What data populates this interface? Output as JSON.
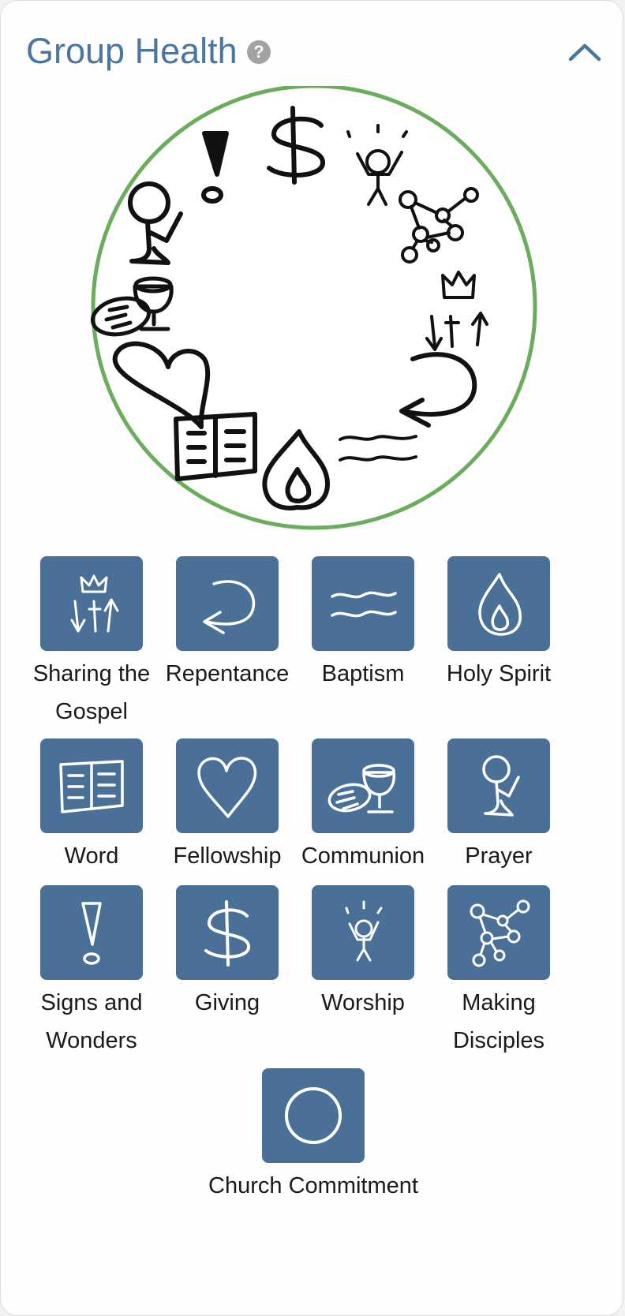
{
  "header": {
    "title": "Group Health",
    "help_glyph": "?",
    "help_icon": "question-circle-icon",
    "collapse_icon": "chevron-up-icon"
  },
  "colors": {
    "accent": "#4a76a0",
    "tile_background": "#4a7098",
    "circle_border": "#6aad5c",
    "help_icon": "#a2a2a2"
  },
  "practices": [
    {
      "label": "Sharing the Gospel",
      "icon": "crown-arrows-icon"
    },
    {
      "label": "Repentance",
      "icon": "u-turn-arrow-icon"
    },
    {
      "label": "Baptism",
      "icon": "water-waves-icon"
    },
    {
      "label": "Holy Spirit",
      "icon": "flame-icon"
    },
    {
      "label": "Word",
      "icon": "open-book-icon"
    },
    {
      "label": "Fellowship",
      "icon": "heart-icon"
    },
    {
      "label": "Communion",
      "icon": "bread-cup-icon"
    },
    {
      "label": "Prayer",
      "icon": "praying-person-icon"
    },
    {
      "label": "Signs and Wonders",
      "icon": "exclamation-icon"
    },
    {
      "label": "Giving",
      "icon": "dollar-icon"
    },
    {
      "label": "Worship",
      "icon": "worship-person-icon"
    },
    {
      "label": "Making Disciples",
      "icon": "disciple-network-icon"
    },
    {
      "label": "Church Commitment",
      "icon": "circle-outline-icon"
    }
  ]
}
